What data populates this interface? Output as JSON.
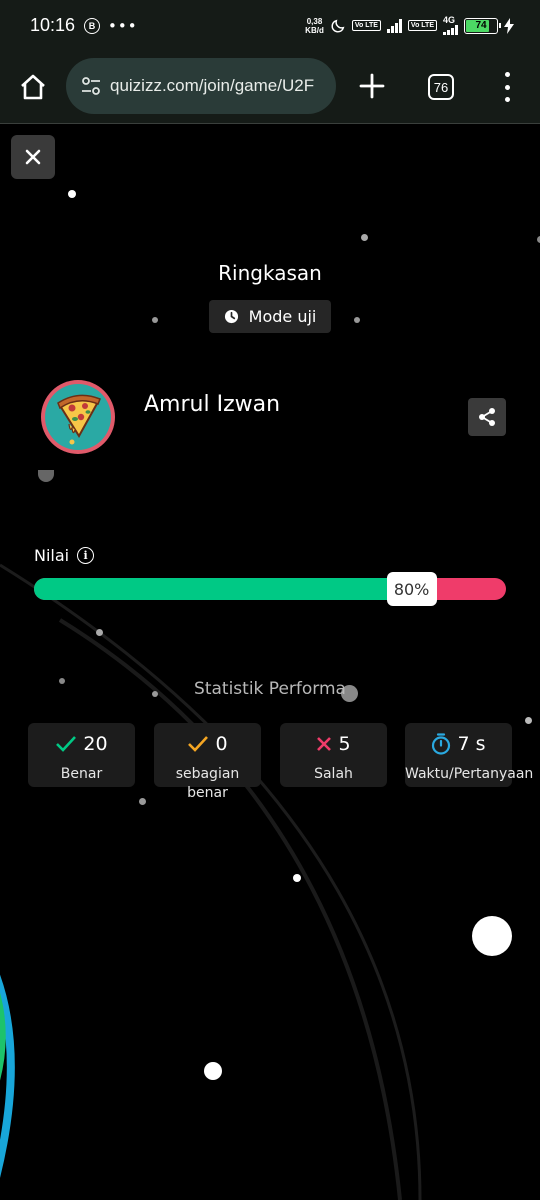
{
  "status_bar": {
    "time": "10:16",
    "b_badge": "B",
    "more": "•••",
    "net_speed_value": "0,38",
    "net_speed_unit": "KB/d",
    "volte1": "Vo LTE",
    "volte2": "Vo LTE",
    "network": "4G",
    "battery_level": "74"
  },
  "browser": {
    "url": "quizizz.com/join/game/U2F",
    "tab_count": "76"
  },
  "summary": {
    "title": "Ringkasan",
    "mode_label": "Mode uji"
  },
  "player": {
    "name": "Amrul Izwan"
  },
  "score": {
    "label": "Nilai",
    "info": "i",
    "percent_text": "80%",
    "percent": 80
  },
  "stats": {
    "title": "Statistik Performa",
    "items": [
      {
        "icon": "check-icon",
        "value": "20",
        "label": "Benar",
        "color": "#00c985"
      },
      {
        "icon": "check-icon",
        "value": "0",
        "label": "sebagian benar",
        "color": "#f5a623"
      },
      {
        "icon": "cross-icon",
        "value": "5",
        "label": "Salah",
        "color": "#ef3c6a"
      },
      {
        "icon": "stopwatch-icon",
        "value": "7 s",
        "label": "Waktu/Pertanyaan",
        "color": "#2aa9e0"
      }
    ]
  },
  "colors": {
    "correct": "#00c985",
    "wrong": "#ef3c6a",
    "background": "#000000",
    "browser_bar": "#151b17"
  }
}
